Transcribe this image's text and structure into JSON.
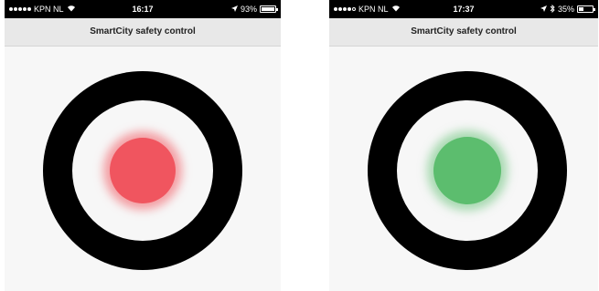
{
  "screens": [
    {
      "status_bar": {
        "carrier": "KPN NL",
        "time": "16:17",
        "battery": "93%",
        "battery_level": 0.93,
        "signal_bars": 5,
        "icons": [
          "wifi-icon",
          "location-icon",
          "battery-icon"
        ]
      },
      "title": "SmartCity safety control",
      "indicator": {
        "state": "red",
        "color": "#f0555f"
      }
    },
    {
      "status_bar": {
        "carrier": "KPN NL",
        "time": "17:37",
        "battery": "35%",
        "battery_level": 0.35,
        "signal_bars": 4,
        "icons": [
          "wifi-icon",
          "location-icon",
          "bluetooth-icon",
          "battery-icon"
        ]
      },
      "title": "SmartCity safety control",
      "indicator": {
        "state": "green",
        "color": "#5cbd6e"
      }
    }
  ]
}
